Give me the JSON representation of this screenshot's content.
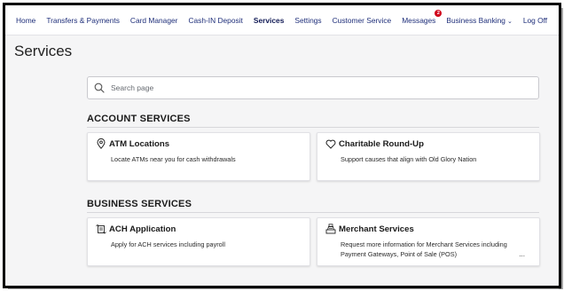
{
  "nav": {
    "items": [
      {
        "label": "Home"
      },
      {
        "label": "Transfers & Payments"
      },
      {
        "label": "Card Manager"
      },
      {
        "label": "Cash-IN Deposit"
      },
      {
        "label": "Services"
      },
      {
        "label": "Settings"
      },
      {
        "label": "Customer Service"
      },
      {
        "label": "Messages"
      },
      {
        "label": "Business Banking"
      },
      {
        "label": "Log Off"
      }
    ],
    "active": "Services",
    "messages_badge": "2",
    "dropdown_icon": "chevron-down-icon"
  },
  "page": {
    "title": "Services"
  },
  "search": {
    "placeholder": "Search page",
    "value": "",
    "icon": "search-icon"
  },
  "sections": {
    "account": {
      "title": "ACCOUNT SERVICES",
      "cards": [
        {
          "title": "ATM Locations",
          "description": "Locate ATMs near you for cash withdrawals",
          "icon": "map-pin-icon"
        },
        {
          "title": "Charitable Round-Up",
          "description": "Support causes that align with Old Glory Nation",
          "icon": "heart-icon"
        }
      ]
    },
    "business": {
      "title": "BUSINESS SERVICES",
      "cards": [
        {
          "title": "ACH Application",
          "description": "Apply for ACH services including payroll",
          "icon": "ach-icon"
        },
        {
          "title": "Merchant Services",
          "description": "Request more information for Merchant Services including Payment Gateways, Point of Sale (POS)",
          "more": "...",
          "icon": "cash-register-icon"
        }
      ]
    }
  },
  "colors": {
    "nav_text": "#1f2f7a",
    "badge": "#d0021b",
    "page_background": "#f5f5f6"
  }
}
